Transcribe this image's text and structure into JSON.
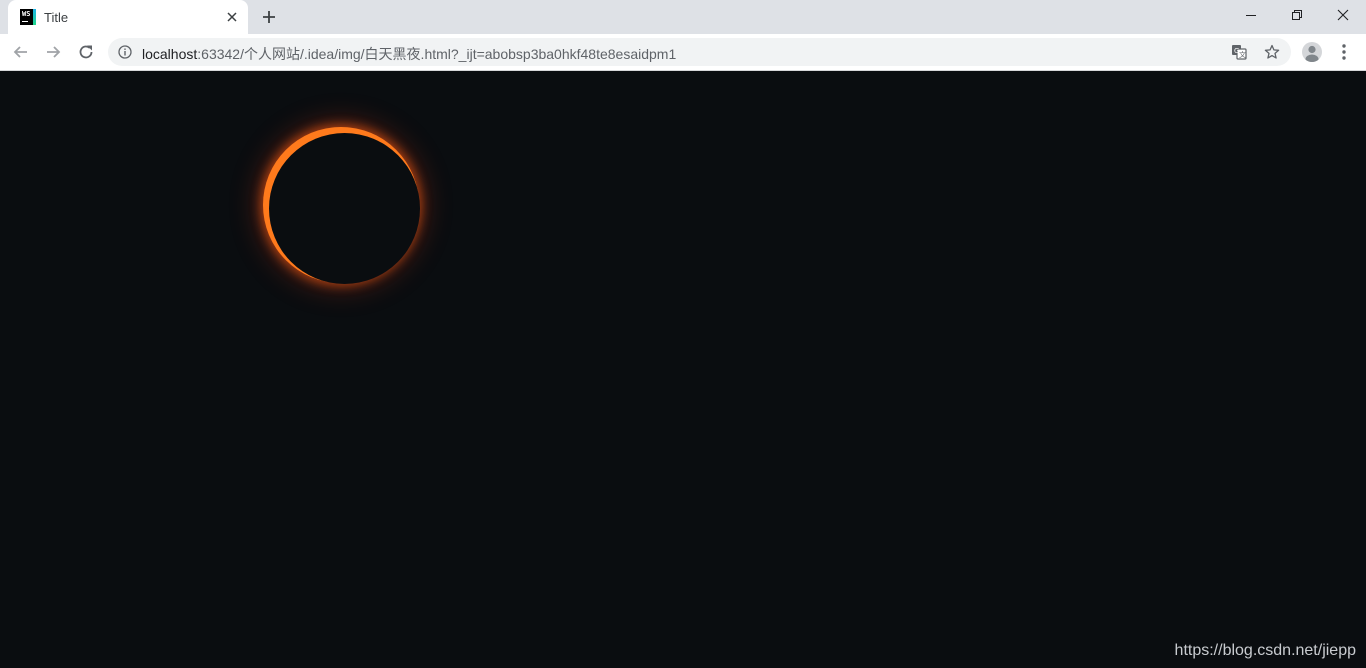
{
  "tab": {
    "title": "Title",
    "favicon_text": "WS",
    "favicon": "webstorm-icon"
  },
  "toolbar": {
    "url_host": "localhost",
    "url_rest": ":63342/个人网站/.idea/img/白天黑夜.html?_ijt=abobsp3ba0hkf48te8esaidpm1",
    "icons": [
      "back-arrow-icon",
      "forward-arrow-icon",
      "reload-icon",
      "info-icon",
      "translate-icon",
      "star-icon",
      "profile-icon",
      "menu-icon"
    ]
  },
  "window_controls": [
    "minimize-icon",
    "restore-icon",
    "close-icon"
  ],
  "page": {
    "watermark": "https://blog.csdn.net/jiepp",
    "colors": {
      "background": "#0a0d10",
      "corona": "#ff7a1c",
      "glow": "#e63c14"
    }
  }
}
